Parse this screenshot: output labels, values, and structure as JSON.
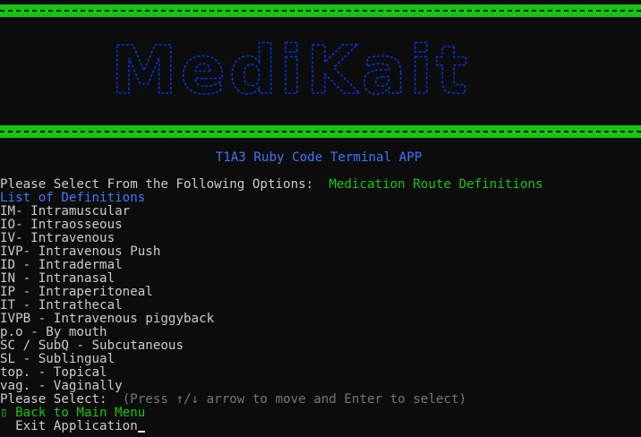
{
  "logo": {
    "text": "MediKait",
    "color": "#0037da"
  },
  "banner": {
    "bar_color": "#16c60c"
  },
  "app_subtitle": "T1A3 Ruby Code Terminal APP",
  "prompt": {
    "label": "Please Select From the Following Options:",
    "selection": "Medication Route Definitions"
  },
  "definitions": {
    "heading": "List of Definitions",
    "items": [
      "IM- Intramuscular",
      "IO- Intraosseous",
      "IV- Intravenous",
      "IVP- Intravenous Push",
      "ID - Intradermal",
      "IN - Intranasal",
      "IP - Intraperitoneal",
      "IT - Intrathecal",
      "IVPB - Intravenous piggyback",
      "p.o - By mouth",
      "SC / SubQ - Subcutaneous",
      "SL - Sublingual",
      "top. - Topical",
      "vag. - Vaginally"
    ]
  },
  "select_prompt": {
    "label": "Please Select:",
    "hint": "(Press ↑/↓ arrow to move and Enter to select)"
  },
  "menu": {
    "pointer": "▯",
    "items": [
      {
        "label": "Back to Main Menu",
        "selected": true
      },
      {
        "label": "Exit Application",
        "selected": false
      }
    ]
  },
  "colors": {
    "background": "#0c0c0c",
    "text": "#cccccc",
    "green": "#16c60c",
    "blue": "#3b78ff",
    "hint": "#767676"
  }
}
